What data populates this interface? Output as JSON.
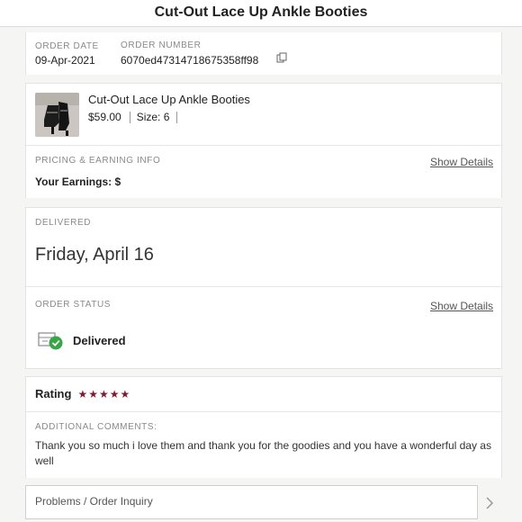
{
  "header": {
    "title": "Cut-Out Lace Up Ankle Booties"
  },
  "order": {
    "date_label": "ORDER DATE",
    "date_value": "09-Apr-2021",
    "number_label": "ORDER NUMBER",
    "number_value": "6070ed47314718675358ff98",
    "copy_icon": "copy-icon"
  },
  "product": {
    "name": "Cut-Out Lace Up Ankle Booties",
    "price": "$59.00",
    "size": "Size: 6",
    "thumbnail_icon": "product-thumbnail"
  },
  "pricing": {
    "label": "PRICING & EARNING INFO",
    "show_details": "Show Details",
    "earnings": "Your Earnings: $"
  },
  "delivery": {
    "label": "DELIVERED",
    "date": "Friday, April 16"
  },
  "status": {
    "label": "ORDER STATUS",
    "show_details": "Show Details",
    "value": "Delivered",
    "icon": "delivered-box-check-icon"
  },
  "rating": {
    "label": "Rating",
    "stars": 5,
    "star_color": "#7b1d33"
  },
  "comments": {
    "label": "ADDITIONAL COMMENTS:",
    "text": "Thank you so much i love them and thank you for the goodies and you have a wonderful day as well"
  },
  "problems": {
    "label": "Problems / Order Inquiry",
    "icon": "chevron-right-icon"
  }
}
